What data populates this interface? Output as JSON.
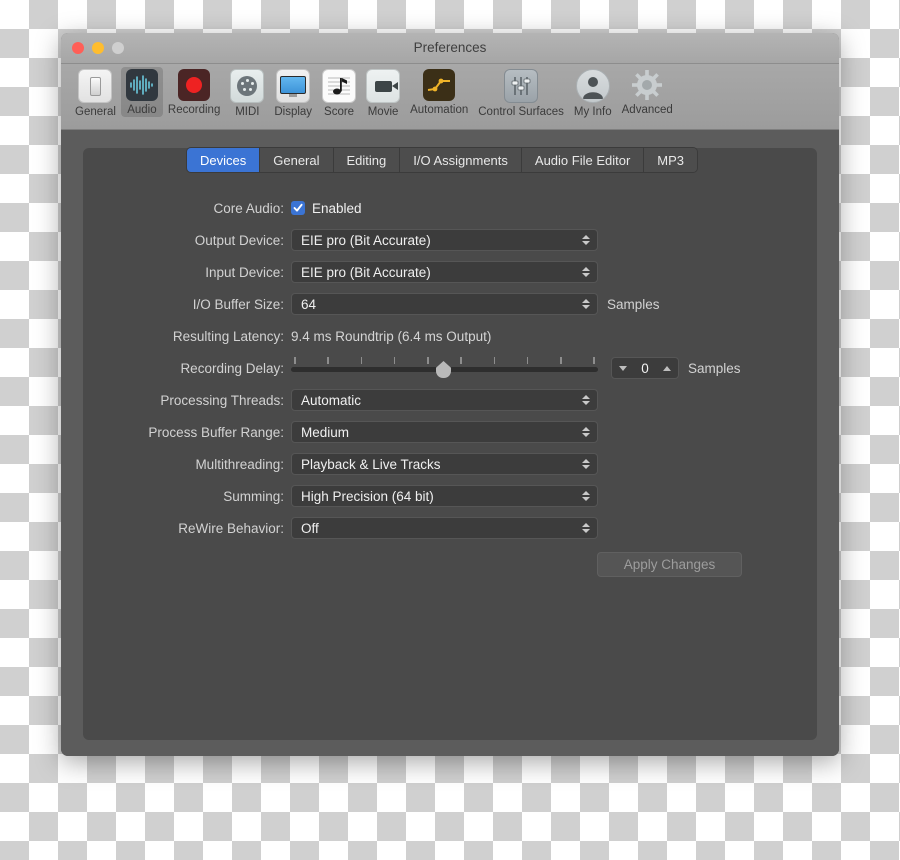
{
  "window": {
    "title": "Preferences",
    "traffic_lights": [
      "close",
      "minimize",
      "zoom"
    ]
  },
  "toolbar": {
    "items": [
      {
        "label": "General",
        "icon": "general-switch-icon",
        "selected": false
      },
      {
        "label": "Audio",
        "icon": "audio-waveform-icon",
        "selected": true
      },
      {
        "label": "Recording",
        "icon": "record-dot-icon",
        "selected": false
      },
      {
        "label": "MIDI",
        "icon": "midi-din-icon",
        "selected": false
      },
      {
        "label": "Display",
        "icon": "display-monitor-icon",
        "selected": false
      },
      {
        "label": "Score",
        "icon": "score-note-icon",
        "selected": false
      },
      {
        "label": "Movie",
        "icon": "movie-camera-icon",
        "selected": false
      },
      {
        "label": "Automation",
        "icon": "automation-curve-icon",
        "selected": false
      },
      {
        "label": "Control Surfaces",
        "icon": "faders-icon",
        "selected": false
      },
      {
        "label": "My Info",
        "icon": "person-icon",
        "selected": false
      },
      {
        "label": "Advanced",
        "icon": "gear-icon",
        "selected": false
      }
    ]
  },
  "tabs": [
    {
      "label": "Devices",
      "active": true
    },
    {
      "label": "General",
      "active": false
    },
    {
      "label": "Editing",
      "active": false
    },
    {
      "label": "I/O Assignments",
      "active": false
    },
    {
      "label": "Audio File Editor",
      "active": false
    },
    {
      "label": "MP3",
      "active": false
    }
  ],
  "form": {
    "core_audio": {
      "label": "Core Audio:",
      "checkbox_label": "Enabled",
      "checked": true
    },
    "output_device": {
      "label": "Output Device:",
      "value": "EIE pro (Bit Accurate)"
    },
    "input_device": {
      "label": "Input Device:",
      "value": "EIE pro (Bit Accurate)"
    },
    "io_buffer_size": {
      "label": "I/O Buffer Size:",
      "value": "64",
      "suffix": "Samples"
    },
    "resulting_latency": {
      "label": "Resulting Latency:",
      "value": "9.4 ms Roundtrip (6.4 ms Output)"
    },
    "recording_delay": {
      "label": "Recording Delay:",
      "value": "0",
      "suffix": "Samples",
      "slider_position_percent": 48,
      "tick_count": 10
    },
    "processing_threads": {
      "label": "Processing Threads:",
      "value": "Automatic"
    },
    "process_buffer_range": {
      "label": "Process Buffer Range:",
      "value": "Medium"
    },
    "multithreading": {
      "label": "Multithreading:",
      "value": "Playback & Live Tracks"
    },
    "summing": {
      "label": "Summing:",
      "value": "High Precision (64 bit)"
    },
    "rewire_behavior": {
      "label": "ReWire Behavior:",
      "value": "Off"
    }
  },
  "apply_button": {
    "label": "Apply Changes",
    "enabled": false
  },
  "colors": {
    "accent_blue": "#3b74d4",
    "panel_bg": "#4a4a4a",
    "body_bg": "#5c5c5c",
    "field_bg": "#3c3c3c",
    "titlebar_top": "#b4b4b4",
    "close_red": "#ff5f57",
    "minimize_yellow": "#ffbd2e",
    "zoom_disabled": "#cfcfcf"
  }
}
